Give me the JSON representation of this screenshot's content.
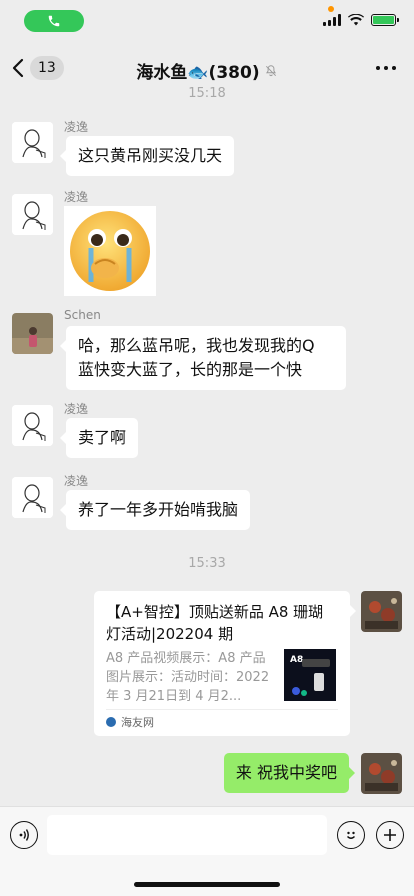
{
  "status_bar": {
    "icons": [
      "phone-icon",
      "signal-icon",
      "wifi-icon",
      "battery-charging-icon"
    ],
    "accent": "#34c759"
  },
  "nav": {
    "unread_count": "13",
    "title": "海水鱼🐟(380)",
    "icons": [
      "back-chevron-icon",
      "mute-bell-icon",
      "more-dots-icon"
    ]
  },
  "chat": {
    "time_top": "15:18",
    "time_mid": "15:33",
    "messages": [
      {
        "sender": "凌逸",
        "text": "这只黄吊刚买没几天"
      },
      {
        "sender": "凌逸",
        "sticker": "crying-emoji-sticker"
      },
      {
        "sender": "Schen",
        "text_line1": "哈，那么蓝吊呢，我也发现我的Q",
        "text_line2": "蓝快变大蓝了，长的那是一个快"
      },
      {
        "sender": "凌逸",
        "text": "卖了啊"
      },
      {
        "sender": "凌逸",
        "text": "养了一年多开始啃我脑"
      }
    ],
    "link_card": {
      "title": "【A+智控】顶贴送新品 A8 珊瑚灯活动|202204 期",
      "desc": "A8 产品视频展示：A8 产品图片展示：活动时间：2022 年 3 月21日到 4 月2...",
      "thumb_brand": "A8",
      "source": "海友网"
    },
    "my_message": "来 祝我中奖吧"
  },
  "input_bar": {
    "placeholder": "",
    "icons": [
      "voice-icon",
      "emoji-icon",
      "plus-icon"
    ]
  },
  "colors": {
    "background": "#ededed",
    "my_bubble": "#95ec69",
    "other_bubble": "#ffffff"
  }
}
